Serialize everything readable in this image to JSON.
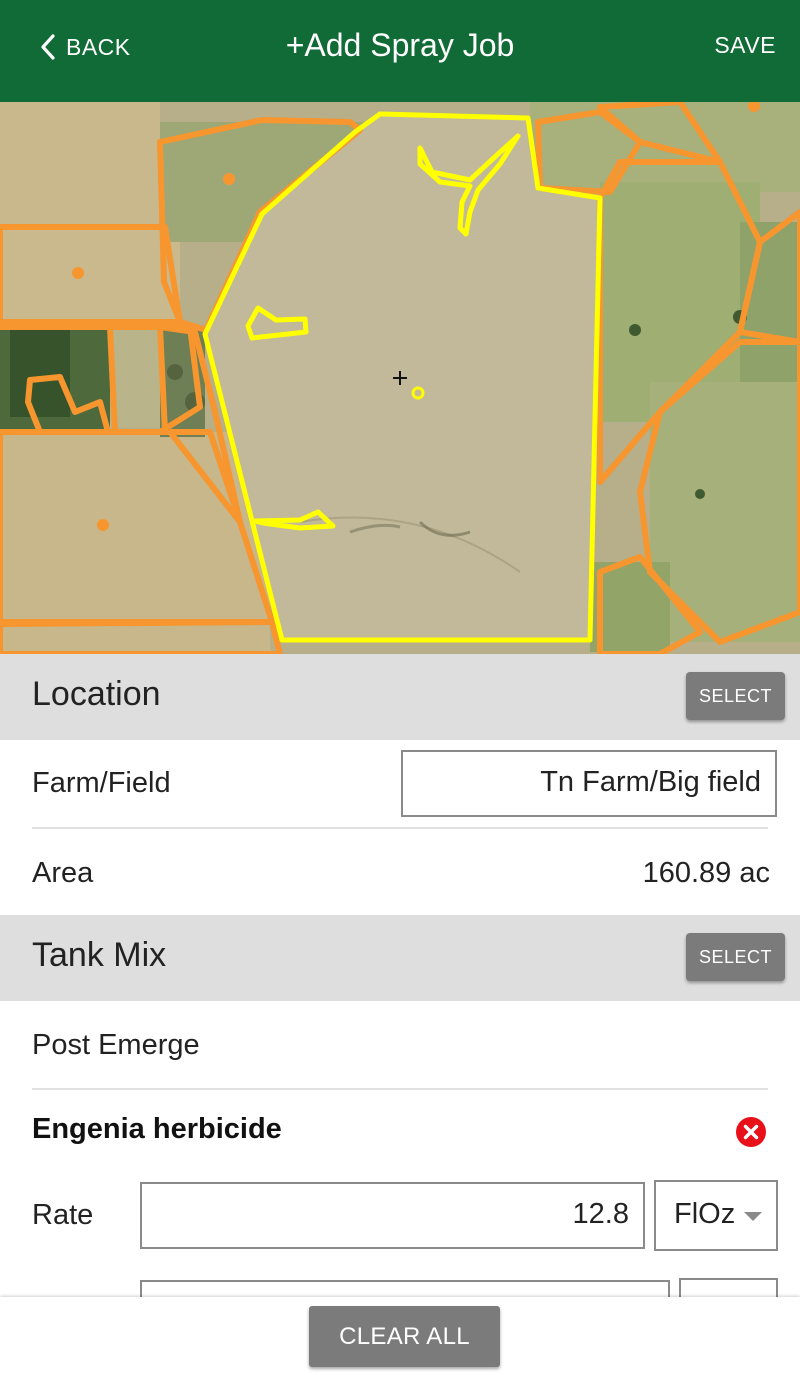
{
  "header": {
    "back_label": "BACK",
    "title": "+Add Spray Job",
    "save_label": "SAVE"
  },
  "map": {
    "field_outline_color": "#ffff00",
    "other_fields_color": "#f7962e"
  },
  "location": {
    "title": "Location",
    "select_label": "SELECT",
    "farm_field_label": "Farm/Field",
    "farm_field_value": "Tn Farm/Big field",
    "area_label": "Area",
    "area_value": "160.89 ac"
  },
  "tank_mix": {
    "title": "Tank Mix",
    "select_label": "SELECT",
    "mix_name": "Post Emerge",
    "products": [
      {
        "name": "Engenia herbicide",
        "rate_label": "Rate",
        "rate_value": "12.8",
        "unit": "FlOz"
      }
    ]
  },
  "footer": {
    "clear_all_label": "CLEAR ALL"
  },
  "colors": {
    "header_bg": "#106b36",
    "section_bg": "#dedede",
    "button_bg": "#7b7b7b",
    "remove_red": "#e8111a"
  }
}
